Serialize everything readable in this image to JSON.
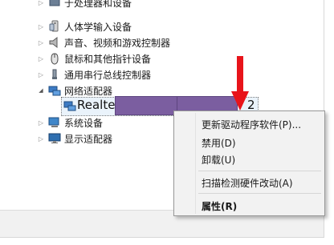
{
  "tree": {
    "items": [
      {
        "label": "人体学输入设备",
        "icon": "hid-icon",
        "state": "collapsed"
      },
      {
        "label": "声音、视频和游戏控制器",
        "icon": "speaker-icon",
        "state": "collapsed"
      },
      {
        "label": "鼠标和其他指针设备",
        "icon": "mouse-icon",
        "state": "collapsed"
      },
      {
        "label": "通用串行总线控制器",
        "icon": "usb-icon",
        "state": "collapsed"
      },
      {
        "label": "网络适配器",
        "icon": "network-icon",
        "state": "expanded"
      },
      {
        "label": "系统设备",
        "icon": "computer-icon",
        "state": "collapsed"
      },
      {
        "label": "显示适配器",
        "icon": "monitor-icon",
        "state": "collapsed"
      }
    ],
    "top_partial": "于处理器和设备",
    "selected_device": {
      "prefix": "Realtek",
      "suffix": "2",
      "icon": "network-card-icon"
    }
  },
  "context_menu": {
    "update_driver": "更新驱动程序软件(P)...",
    "disable": "禁用(D)",
    "uninstall": "卸载(U)",
    "scan": "扫描检测硬件改动(A)",
    "properties": "属性(R)"
  },
  "colors": {
    "arrow_red": "#e8141b",
    "redaction": "#7b5ea0",
    "menu_bg": "#f2f2f2"
  }
}
